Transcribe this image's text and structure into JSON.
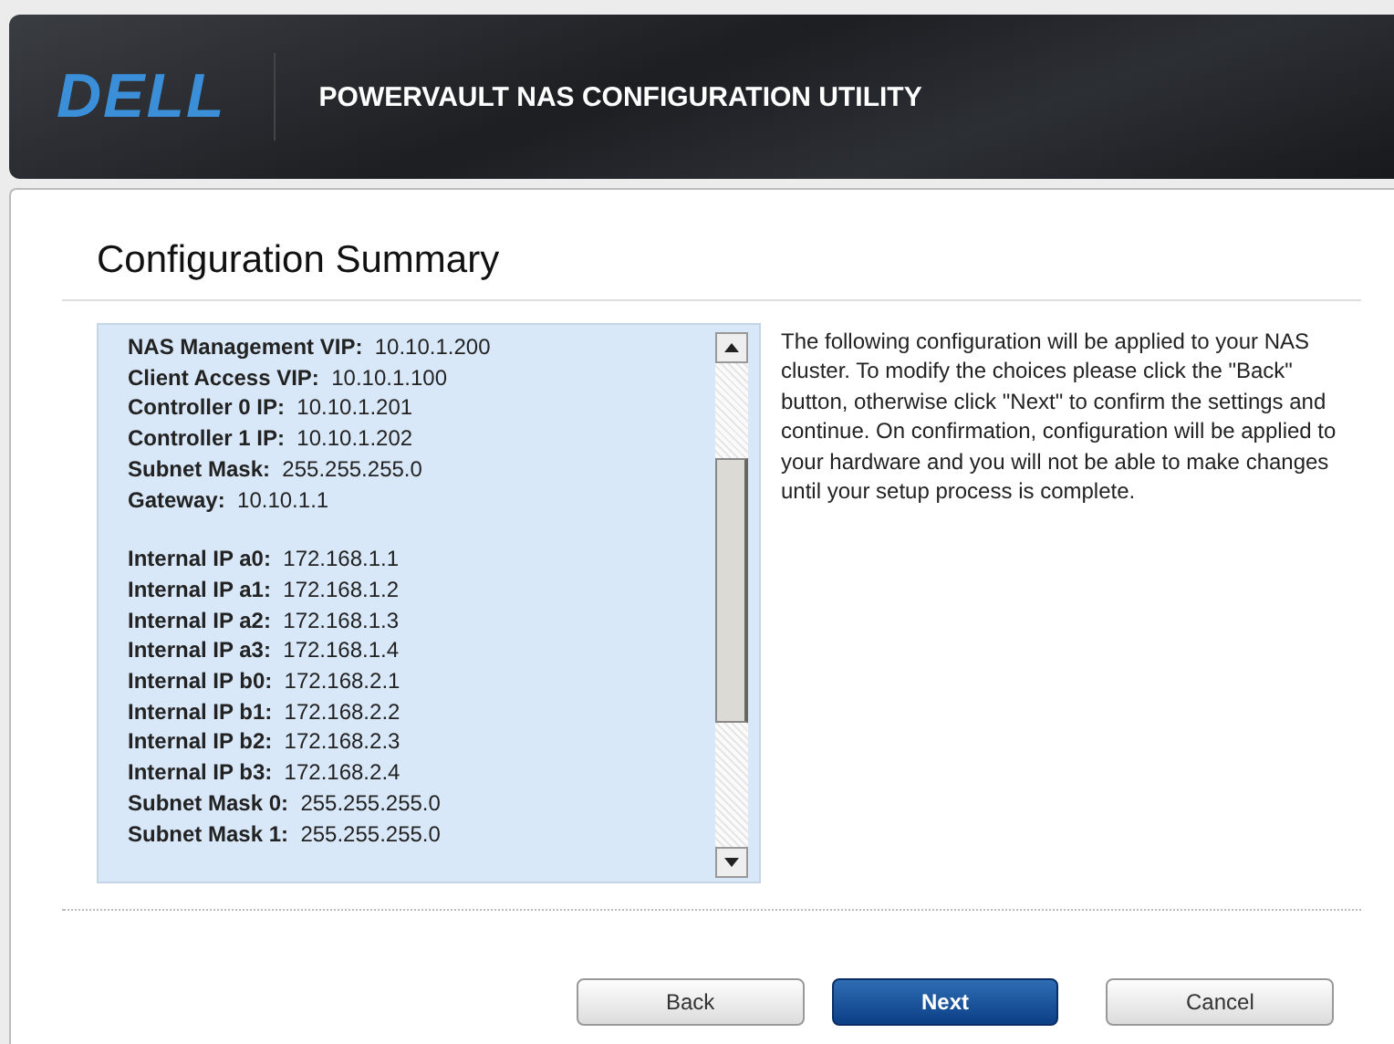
{
  "header": {
    "logo": "DELL",
    "title": "POWERVAULT NAS CONFIGURATION UTILITY"
  },
  "page_title": "Configuration Summary",
  "summary_groups": [
    {
      "items": [
        {
          "label": "NAS Management VIP:",
          "value": "10.10.1.200"
        },
        {
          "label": "Client Access VIP:",
          "value": "10.10.1.100"
        },
        {
          "label": "Controller 0 IP:",
          "value": "10.10.1.201"
        },
        {
          "label": "Controller 1 IP:",
          "value": "10.10.1.202"
        },
        {
          "label": "Subnet Mask:",
          "value": "255.255.255.0"
        },
        {
          "label": "Gateway:",
          "value": "10.10.1.1"
        }
      ]
    },
    {
      "items": [
        {
          "label": "Internal IP a0:",
          "value": "172.168.1.1"
        },
        {
          "label": "Internal IP a1:",
          "value": "172.168.1.2"
        },
        {
          "label": "Internal IP a2:",
          "value": "172.168.1.3"
        },
        {
          "label": "Internal IP a3:",
          "value": "172.168.1.4"
        },
        {
          "label": "Internal IP b0:",
          "value": "172.168.2.1"
        },
        {
          "label": "Internal IP b1:",
          "value": "172.168.2.2"
        },
        {
          "label": "Internal IP b2:",
          "value": "172.168.2.3"
        },
        {
          "label": "Internal IP b3:",
          "value": "172.168.2.4"
        },
        {
          "label": "Subnet Mask 0:",
          "value": "255.255.255.0"
        },
        {
          "label": "Subnet Mask 1:",
          "value": "255.255.255.0"
        }
      ]
    }
  ],
  "instructions": "The following configuration will be applied to your NAS cluster.  To modify the choices please click the \"Back\" button, otherwise click \"Next\" to confirm the settings and continue. On confirmation, configuration will be applied to your hardware and you will not be able to make changes until your setup process is complete.",
  "buttons": [
    {
      "label": "Back",
      "primary": false
    },
    {
      "label": "Next",
      "primary": true
    },
    {
      "label": "Cancel",
      "primary": false
    }
  ]
}
